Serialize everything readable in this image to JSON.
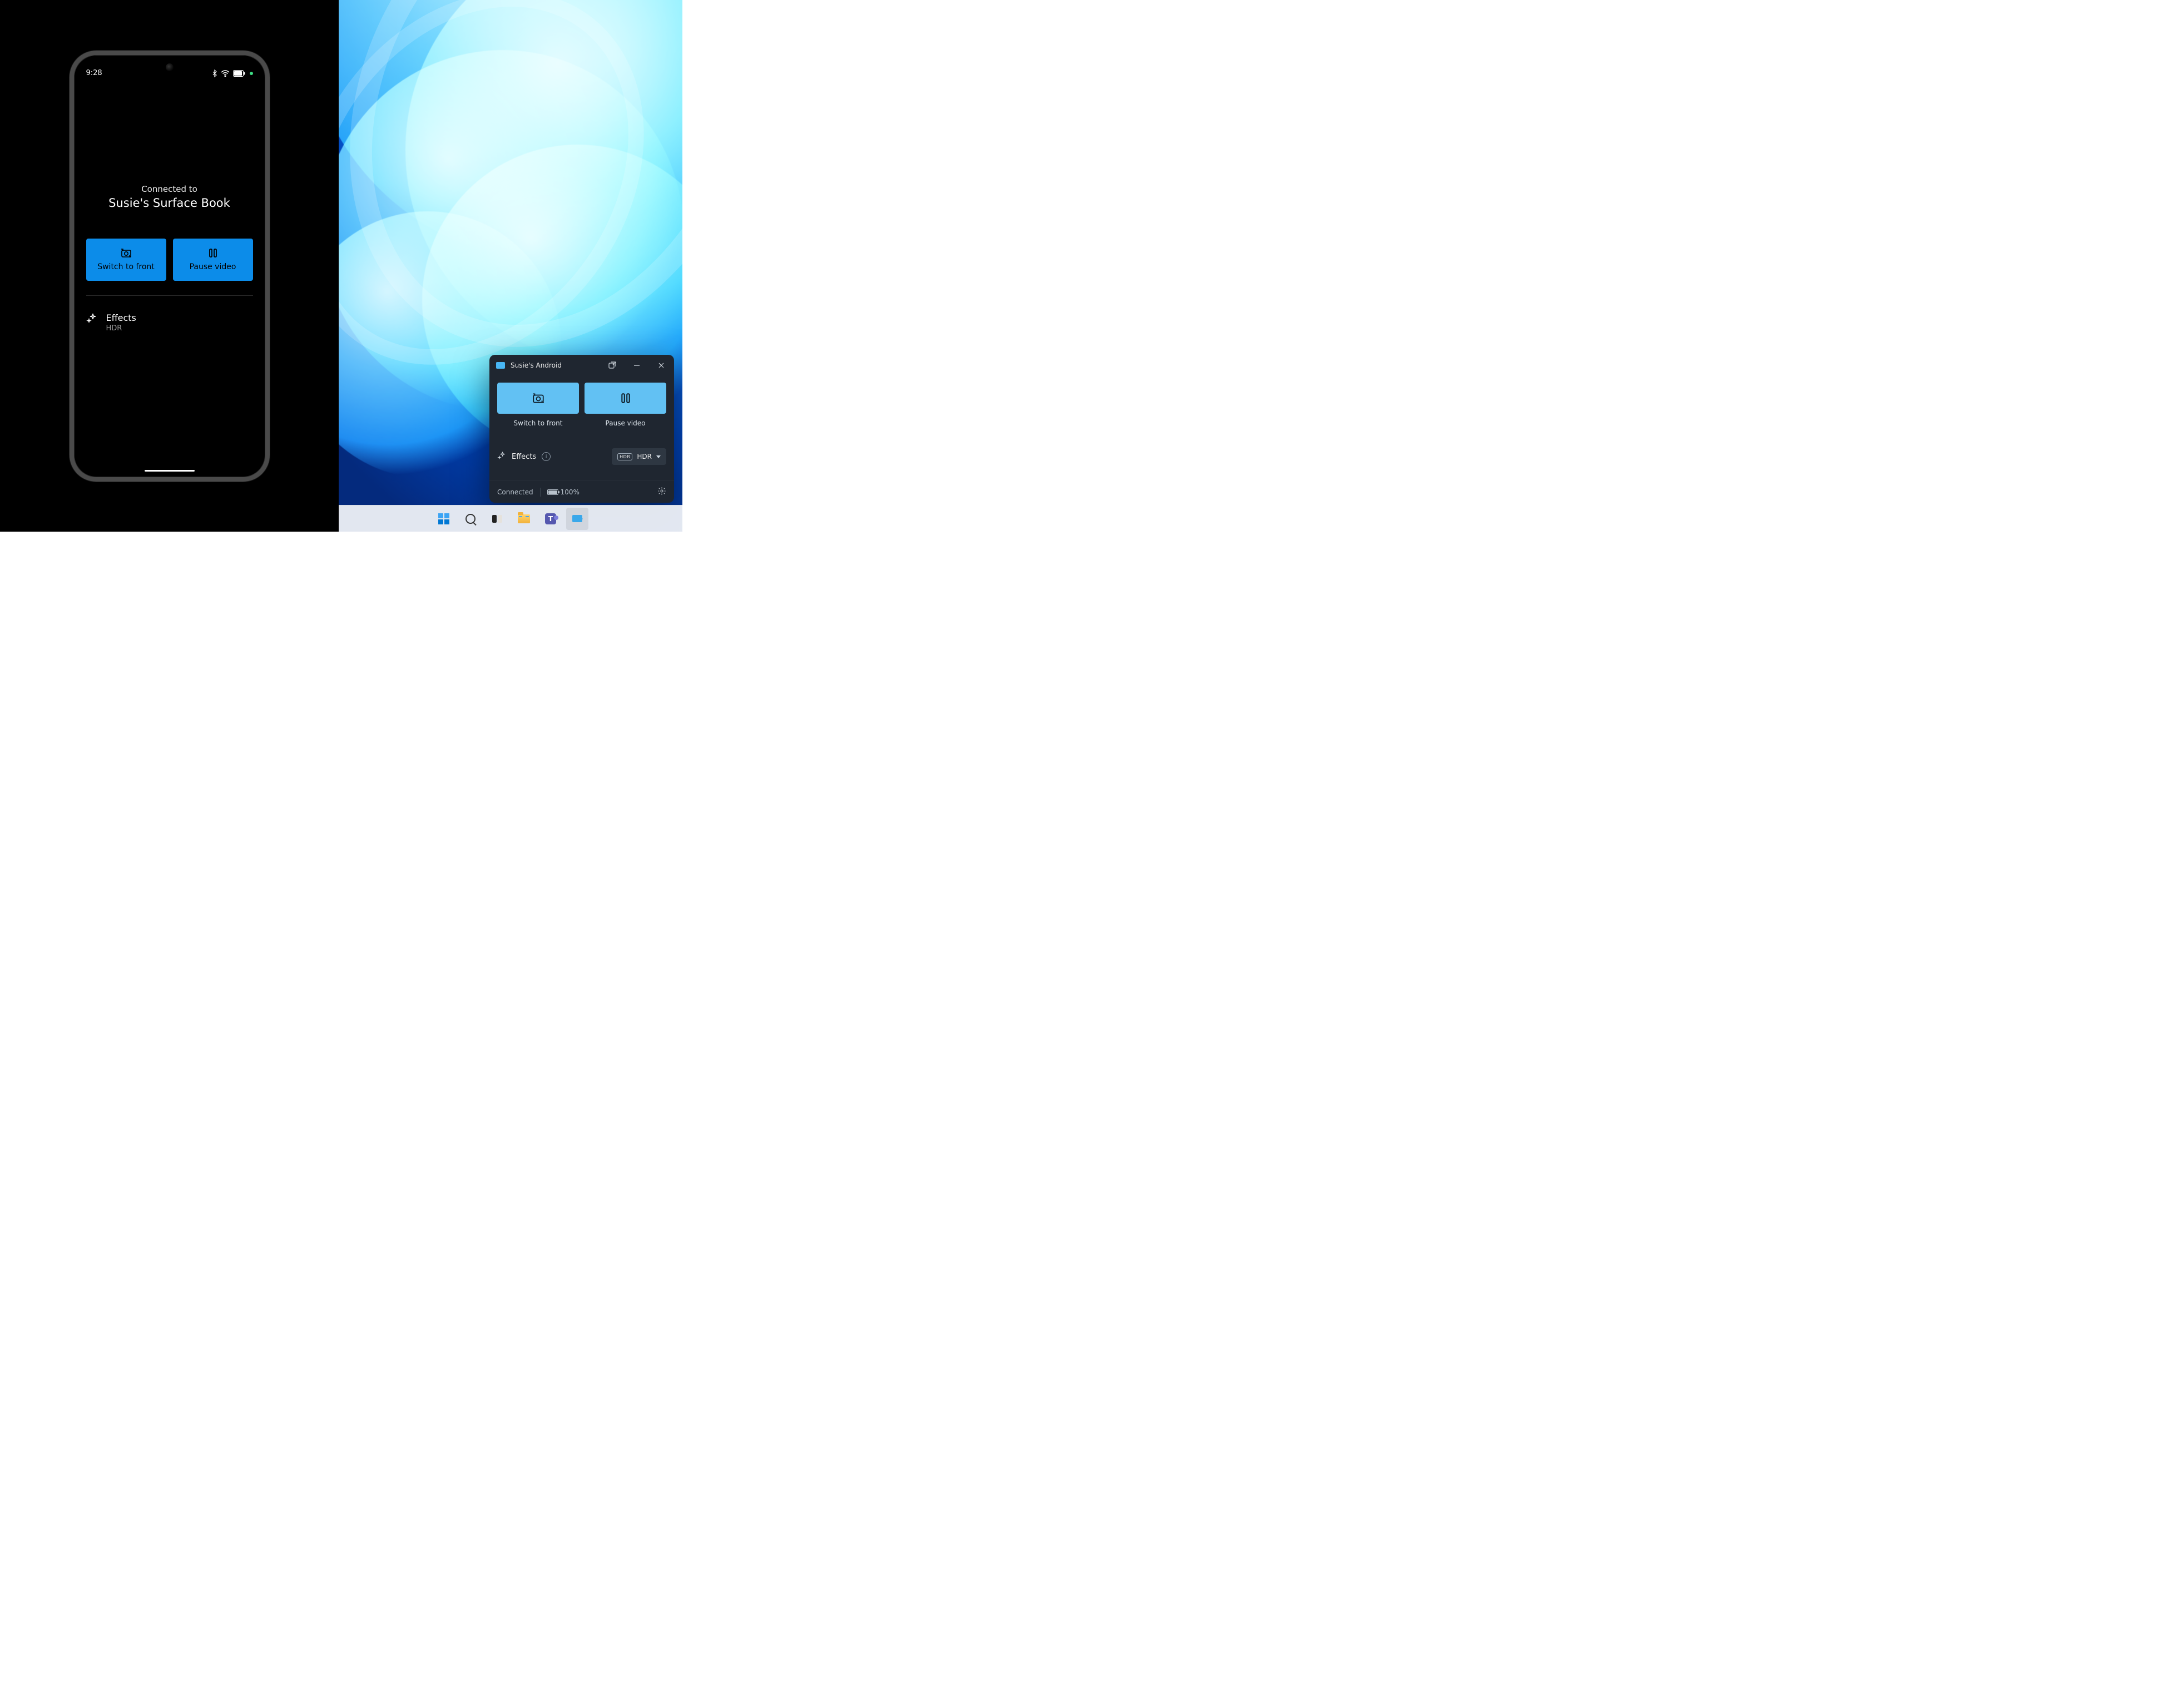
{
  "phone": {
    "status_bar": {
      "time": "9:28"
    },
    "connected_label": "Connected to",
    "connected_device": "Susie's Surface Book",
    "buttons": {
      "switch_label": "Switch to front",
      "pause_label": "Pause video"
    },
    "effects": {
      "title": "Effects",
      "subtitle": "HDR"
    }
  },
  "desktop": {
    "window": {
      "title": "Susie's Android",
      "switch_label": "Switch to front",
      "pause_label": "Pause video",
      "effects_label": "Effects",
      "hdr_label": "HDR",
      "status": "Connected",
      "battery": "100%"
    }
  }
}
